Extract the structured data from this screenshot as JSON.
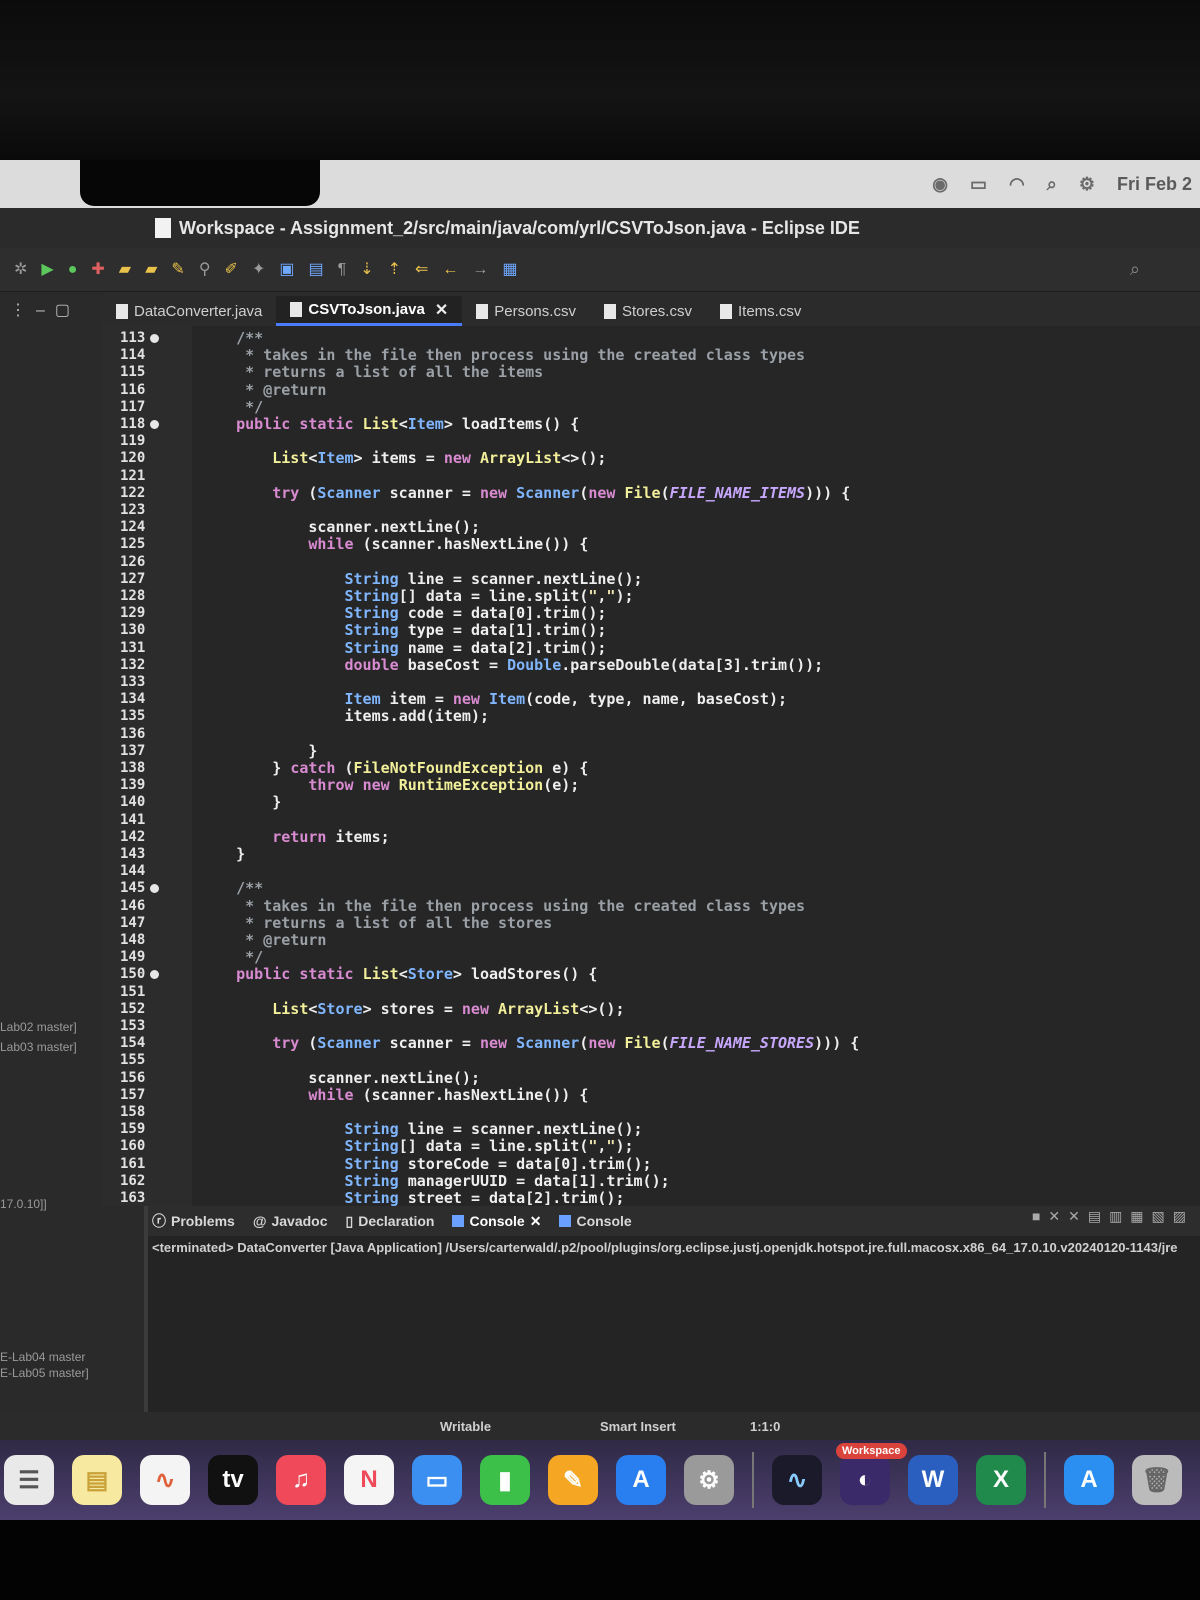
{
  "menubar": {
    "clock": "Fri Feb 2"
  },
  "window": {
    "title": "Workspace - Assignment_2/src/main/java/com/yrl/CSVToJson.java - Eclipse IDE"
  },
  "left_panel": {
    "items": [
      "Lab02 master]",
      "Lab03 master]",
      "17.0.10]]",
      "E-Lab04 master",
      "E-Lab05 master]"
    ]
  },
  "tabs": [
    {
      "label": "DataConverter.java",
      "active": false
    },
    {
      "label": "CSVToJson.java",
      "active": true
    },
    {
      "label": "Persons.csv",
      "active": false
    },
    {
      "label": "Stores.csv",
      "active": false
    },
    {
      "label": "Items.csv",
      "active": false
    }
  ],
  "editor": {
    "line_numbers": [
      "113",
      "114",
      "115",
      "116",
      "117",
      "118",
      "119",
      "120",
      "121",
      "122",
      "123",
      "124",
      "125",
      "126",
      "127",
      "128",
      "129",
      "130",
      "131",
      "132",
      "133",
      "134",
      "135",
      "136",
      "137",
      "138",
      "139",
      "140",
      "141",
      "142",
      "143",
      "144",
      "145",
      "146",
      "147",
      "148",
      "149",
      "150",
      "151",
      "152",
      "153",
      "154",
      "155",
      "156",
      "157",
      "158",
      "159",
      "160",
      "161",
      "162",
      "163"
    ],
    "code": [
      "    /**",
      "     * takes in the file then process using the created class types",
      "     * returns a list of all the items",
      "     * @return",
      "     */",
      "    public static List<Item> loadItems() {",
      "",
      "        List<Item> items = new ArrayList<>();",
      "",
      "        try (Scanner scanner = new Scanner(new File(FILE_NAME_ITEMS))) {",
      "",
      "            scanner.nextLine();",
      "            while (scanner.hasNextLine()) {",
      "",
      "                String line = scanner.nextLine();",
      "                String[] data = line.split(\",\");",
      "                String code = data[0].trim();",
      "                String type = data[1].trim();",
      "                String name = data[2].trim();",
      "                double baseCost = Double.parseDouble(data[3].trim());",
      "",
      "                Item item = new Item(code, type, name, baseCost);",
      "                items.add(item);",
      "",
      "            }",
      "        } catch (FileNotFoundException e) {",
      "            throw new RuntimeException(e);",
      "        }",
      "",
      "        return items;",
      "    }",
      "",
      "    /**",
      "     * takes in the file then process using the created class types",
      "     * returns a list of all the stores",
      "     * @return",
      "     */",
      "    public static List<Store> loadStores() {",
      "",
      "        List<Store> stores = new ArrayList<>();",
      "",
      "        try (Scanner scanner = new Scanner(new File(FILE_NAME_STORES))) {",
      "",
      "            scanner.nextLine();",
      "            while (scanner.hasNextLine()) {",
      "",
      "                String line = scanner.nextLine();",
      "                String[] data = line.split(\",\");",
      "                String storeCode = data[0].trim();",
      "                String managerUUID = data[1].trim();",
      "                String street = data[2].trim();"
    ],
    "fold_markers": [
      "113",
      "118",
      "145",
      "150"
    ]
  },
  "console": {
    "tabs": [
      "Problems",
      "Javadoc",
      "Declaration",
      "Console",
      "Console"
    ],
    "active_tab": 3,
    "terminated": "<terminated> DataConverter [Java Application] /Users/carterwald/.p2/pool/plugins/org.eclipse.justj.openjdk.hotspot.jre.full.macosx.x86_64_17.0.10.v20240120-1143/jre"
  },
  "statusbar": {
    "writable": "Writable",
    "insert_mode": "Smart Insert",
    "position": "1:1:0"
  },
  "dock": {
    "badge": "Workspace",
    "tv_label": "tv"
  }
}
